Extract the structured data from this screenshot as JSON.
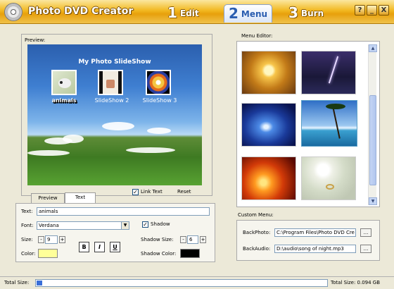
{
  "app": {
    "title": "Photo DVD Creator"
  },
  "steps": [
    {
      "num": "1",
      "label": "Edit"
    },
    {
      "num": "2",
      "label": "Menu"
    },
    {
      "num": "3",
      "label": "Burn"
    }
  ],
  "window_buttons": {
    "help": "?",
    "minimize": "_",
    "close": "X"
  },
  "preview": {
    "label": "Preview:",
    "menu_title": "My Photo SlideShow",
    "thumbnails": [
      "animals",
      "SlideShow 2",
      "SlideShow 3"
    ],
    "link_text_label": "Link Text",
    "link_text_checked": true,
    "reset_label": "Reset"
  },
  "tabs": [
    "Preview",
    "Text"
  ],
  "text_panel": {
    "text_label": "Text:",
    "text_value": "animals",
    "font_label": "Font:",
    "font_value": "Verdana",
    "size_label": "Size:",
    "size_value": "9",
    "color_label": "Color:",
    "text_color": "#ffff99",
    "bold": "B",
    "italic": "I",
    "underline": "U",
    "shadow_label": "Shadow",
    "shadow_checked": true,
    "shadow_size_label": "Shadow Size:",
    "shadow_size_value": "6",
    "shadow_color_label": "Shadow Color:",
    "shadow_color": "#000000",
    "minus": "-",
    "plus": "+"
  },
  "menu_editor": {
    "label": "Menu Editor:",
    "backgrounds": [
      "golden-sun",
      "lightning",
      "blue-light",
      "palm-beach",
      "solar-flare",
      "wedding-roses"
    ]
  },
  "custom_menu": {
    "label": "Custom Menu:",
    "back_photo_label": "BackPhoto:",
    "back_photo_value": "C:\\Program Files\\Photo DVD Cre",
    "back_audio_label": "BackAudio:",
    "back_audio_value": "D:\\audio\\song of night.mp3",
    "browse": "..."
  },
  "status": {
    "total_size_label": "Total Size:",
    "total_size_text": "Total Size: 0.094 GB",
    "progress_fraction": 0.02
  }
}
